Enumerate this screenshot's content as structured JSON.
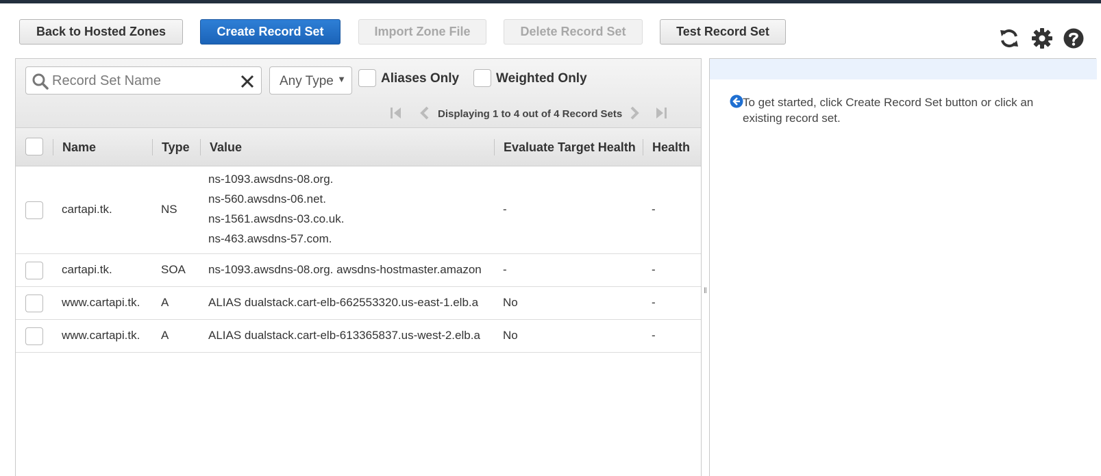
{
  "toolbar": {
    "back_label": "Back to Hosted Zones",
    "create_label": "Create Record Set",
    "import_label": "Import Zone File",
    "delete_label": "Delete Record Set",
    "test_label": "Test Record Set"
  },
  "top_icons": [
    "refresh-icon",
    "gear-icon",
    "help-icon"
  ],
  "filter": {
    "search_placeholder": "Record Set Name",
    "type_value": "Any Type",
    "aliases_label": "Aliases Only",
    "weighted_label": "Weighted Only"
  },
  "pager": {
    "text": "Displaying 1 to 4 out of 4 Record Sets"
  },
  "table": {
    "headers": {
      "name": "Name",
      "type": "Type",
      "value": "Value",
      "eval": "Evaluate Target Health",
      "health": "Health"
    },
    "rows": [
      {
        "name": "cartapi.tk.",
        "type": "NS",
        "values": [
          "ns-1093.awsdns-08.org.",
          "ns-560.awsdns-06.net.",
          "ns-1561.awsdns-03.co.uk.",
          "ns-463.awsdns-57.com."
        ],
        "eval": "-",
        "health": "-"
      },
      {
        "name": "cartapi.tk.",
        "type": "SOA",
        "values": [
          "ns-1093.awsdns-08.org. awsdns-hostmaster.amazon"
        ],
        "eval": "-",
        "health": "-"
      },
      {
        "name": "www.cartapi.tk.",
        "type": "A",
        "values": [
          "ALIAS dualstack.cart-elb-662553320.us-east-1.elb.a"
        ],
        "eval": "No",
        "health": "-"
      },
      {
        "name": "www.cartapi.tk.",
        "type": "A",
        "values": [
          "ALIAS dualstack.cart-elb-613365837.us-west-2.elb.a"
        ],
        "eval": "No",
        "health": "-"
      }
    ]
  },
  "right_panel": {
    "info_text": "To get started, click Create Record Set button or click an existing record set."
  },
  "colors": {
    "primary": "#1b63b8",
    "topbar": "#232f3e",
    "right_header": "#eaf2fd"
  }
}
